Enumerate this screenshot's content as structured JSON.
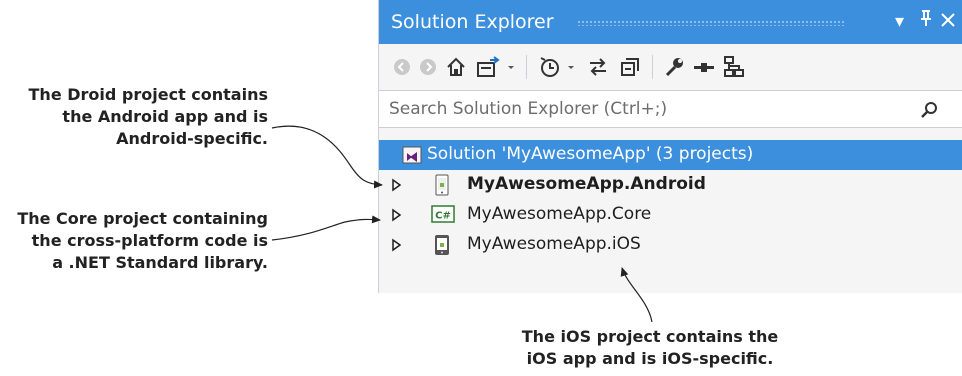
{
  "window": {
    "title": "Solution Explorer",
    "buttons": {
      "dropdown": "▾",
      "pin": "⊥",
      "close": "✕"
    }
  },
  "toolbar": {
    "icons": [
      "back-icon",
      "forward-icon",
      "home-icon",
      "switch-views-icon",
      "dropdown-icon",
      "pending-changes-icon",
      "dropdown-icon",
      "sync-icon",
      "collapse-all-icon",
      "properties-icon",
      "preview-icon",
      "view-class-diagram-icon"
    ]
  },
  "search": {
    "placeholder": "Search Solution Explorer (Ctrl+;)"
  },
  "tree": {
    "solution": "Solution 'MyAwesomeApp' (3 projects)",
    "projects": [
      {
        "label": "MyAwesomeApp.Android",
        "icon": "android-project-icon",
        "bold": true
      },
      {
        "label": "MyAwesomeApp.Core",
        "icon": "csharp-project-icon",
        "bold": false
      },
      {
        "label": "MyAwesomeApp.iOS",
        "icon": "ios-project-icon",
        "bold": false
      }
    ]
  },
  "annotations": {
    "droid": [
      "The Droid project contains",
      "the Android app and is",
      "Android-specific."
    ],
    "core": [
      "The Core project containing",
      "the cross-platform code is",
      "a .NET Standard library."
    ],
    "ios": [
      "The iOS project contains the",
      "iOS app and is iOS-specific."
    ]
  },
  "colors": {
    "accent": "#3c8fdc",
    "panel_bg": "#f5f5f5",
    "text": "#1e1e1e"
  }
}
